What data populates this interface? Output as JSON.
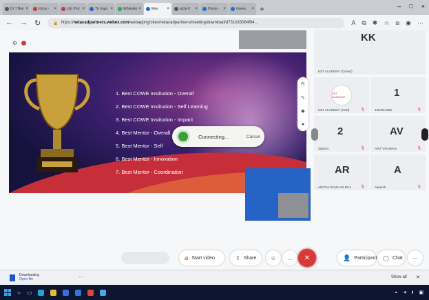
{
  "browser": {
    "tabs": [
      {
        "label": "Dr T Ben",
        "icon": "document-icon",
        "color": "#555555"
      },
      {
        "label": "Inbox - ",
        "icon": "mail-icon",
        "color": "#c23b3b"
      },
      {
        "label": "Job Port",
        "icon": "mail-icon",
        "color": "#c23b3b"
      },
      {
        "label": "Th Impo",
        "icon": "heart-icon",
        "color": "#2a62c9"
      },
      {
        "label": "WhatsAp",
        "icon": "whatsapp-icon",
        "color": "#2aa84a"
      },
      {
        "label": "Mee",
        "icon": "webex-icon",
        "color": "#1f6fd1",
        "active": true
      },
      {
        "label": "aicte-fi",
        "icon": "document-icon",
        "color": "#555555"
      },
      {
        "label": "Home - ",
        "icon": "globe-icon",
        "color": "#1f6fd1"
      },
      {
        "label": "Green ",
        "icon": "globe-icon",
        "color": "#1f6fd1"
      }
    ],
    "new_tab": "+",
    "url_prefix": "https://",
    "url_host": "netacadpartners.webex.com",
    "url_path": "/webappng/sites/netacadpartners/meeting/download/d731b33064f94..."
  },
  "meeting": {
    "slide_items": [
      "1.  Best COWE Institution - Overall",
      "2.  Best COWE Institution - Self Learning",
      "3.  Best COWE Institution - Impact",
      "4.  Best Mentor - Overall",
      "5.  Best Mentor - Self",
      "6.  Best Mentor - Innovation",
      "7.  Best Mentor - Coordination"
    ],
    "connecting_text": "Connecting...",
    "cancel_label": "Cancel",
    "participants": [
      {
        "initials": "KK",
        "name": "KST ACADEMY (Cohort)"
      },
      {
        "initials": "",
        "name": "KST ACADEMY (Host)",
        "logo": "KST ACADEMY"
      },
      {
        "initials": "1",
        "name": "1357614550"
      },
      {
        "initials": "2",
        "name": "353344"
      },
      {
        "initials": "AV",
        "name": "ARIT VISHWAS"
      },
      {
        "initials": "AR",
        "name": "ANITHA RAMA AR BCA"
      },
      {
        "initials": "A",
        "name": "Aakarsh"
      }
    ]
  },
  "controls": {
    "start_video": "Start video",
    "share": "Share",
    "participants": "Participants",
    "chat": "Chat",
    "more": "...",
    "end": "✕"
  },
  "downloads": {
    "file_name": "Downloading",
    "status": "Open file",
    "show_all": "Show all",
    "close": "✕"
  },
  "colors": {
    "end_call": "#d83a3a",
    "slide_red": "#c62f3a",
    "slide_purple": "#3b1f6e",
    "connect_green": "#3e9e3a",
    "share_blue": "#2563c4"
  }
}
